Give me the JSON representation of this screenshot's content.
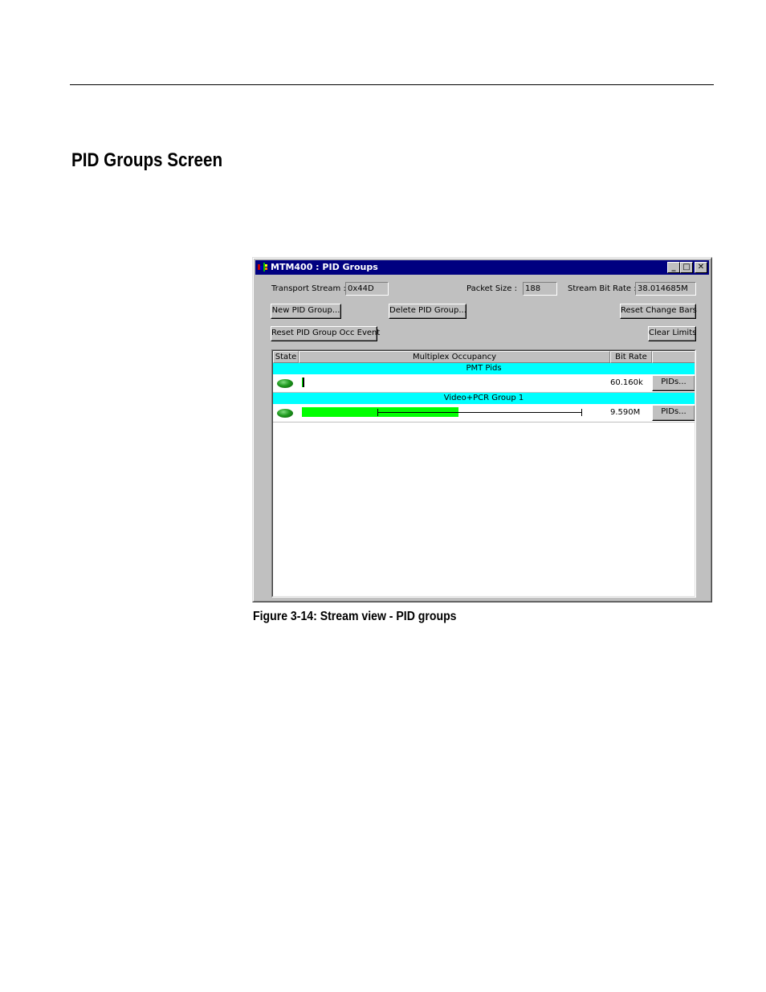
{
  "document": {
    "heading": "PID Groups Screen",
    "figure_caption": "Figure 3-14: Stream view - PID groups"
  },
  "window": {
    "title": "MTM400 : PID Groups",
    "app_icon": "mtm400-app-icon",
    "controls": {
      "minimize": "_",
      "maximize": "□",
      "close": "✕"
    }
  },
  "fields": {
    "transport_stream": {
      "label": "Transport Stream :",
      "value": "0x44D"
    },
    "packet_size": {
      "label": "Packet Size :",
      "value": "188"
    },
    "stream_bit_rate": {
      "label": "Stream Bit Rate :",
      "value": "38.014685M"
    }
  },
  "buttons": {
    "new_pid_group": "New PID Group...",
    "delete_pid_group": "Delete PID Group...",
    "reset_change_bars": "Reset Change Bars",
    "reset_pid_group_occ_event": "Reset PID Group Occ Event",
    "clear_limits": "Clear Limits"
  },
  "list": {
    "columns": [
      "State",
      "Multiplex Occupancy",
      "Bit Rate",
      ""
    ],
    "groups": [
      {
        "name": "PMT Pids",
        "state": "ok",
        "state_color": "#1f9a1f",
        "occupancy_fraction": 0.005,
        "min_fraction": null,
        "max_fraction": null,
        "bit_rate": "60.160k",
        "button": "PIDs..."
      },
      {
        "name": "Video+PCR Group 1",
        "state": "ok",
        "state_color": "#1f9a1f",
        "occupancy_fraction": 0.56,
        "min_fraction": 0.27,
        "max_fraction": 1.0,
        "bit_rate": "9.590M",
        "button": "PIDs..."
      }
    ]
  },
  "colors": {
    "title_bar": "#000080",
    "group_header": "#00ffff",
    "occupancy_bar": "#00ff00",
    "window_face": "#c0c0c0"
  }
}
